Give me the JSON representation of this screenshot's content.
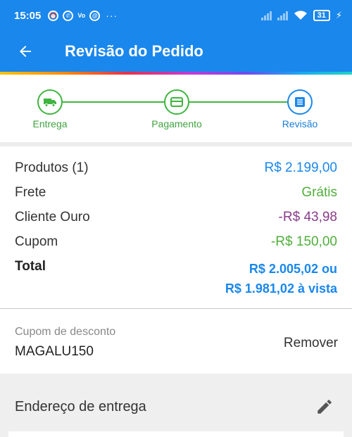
{
  "status_bar": {
    "time": "15:05",
    "icons": [
      "alarm-icon",
      "whatsapp-icon",
      "volte-icon",
      "app-icon"
    ],
    "more": "···",
    "battery": "31"
  },
  "app_bar": {
    "title": "Revisão do Pedido",
    "back_icon": "arrow-left-icon"
  },
  "stepper": {
    "steps": [
      {
        "label": "Entrega",
        "icon": "truck-icon",
        "state": "done"
      },
      {
        "label": "Pagamento",
        "icon": "card-icon",
        "state": "done"
      },
      {
        "label": "Revisão",
        "icon": "list-icon",
        "state": "current"
      }
    ]
  },
  "summary": {
    "products_label": "Produtos (1)",
    "products_value": "R$ 2.199,00",
    "shipping_label": "Frete",
    "shipping_value": "Grátis",
    "gold_label": "Cliente Ouro",
    "gold_value": "-R$ 43,98",
    "coupon_label": "Cupom",
    "coupon_value": "-R$ 150,00",
    "total_label": "Total",
    "total_value": "R$ 2.005,02 ou",
    "total_cash": "R$ 1.981,02 à vista"
  },
  "coupon": {
    "label": "Cupom de desconto",
    "code": "MAGALU150",
    "remove_label": "Remover"
  },
  "address": {
    "title": "Endereço de entrega",
    "edit_icon": "pencil-icon"
  },
  "colors": {
    "primary": "#1a87ec",
    "success": "#3fb53f",
    "discount_purple": "#8a3c8c"
  }
}
